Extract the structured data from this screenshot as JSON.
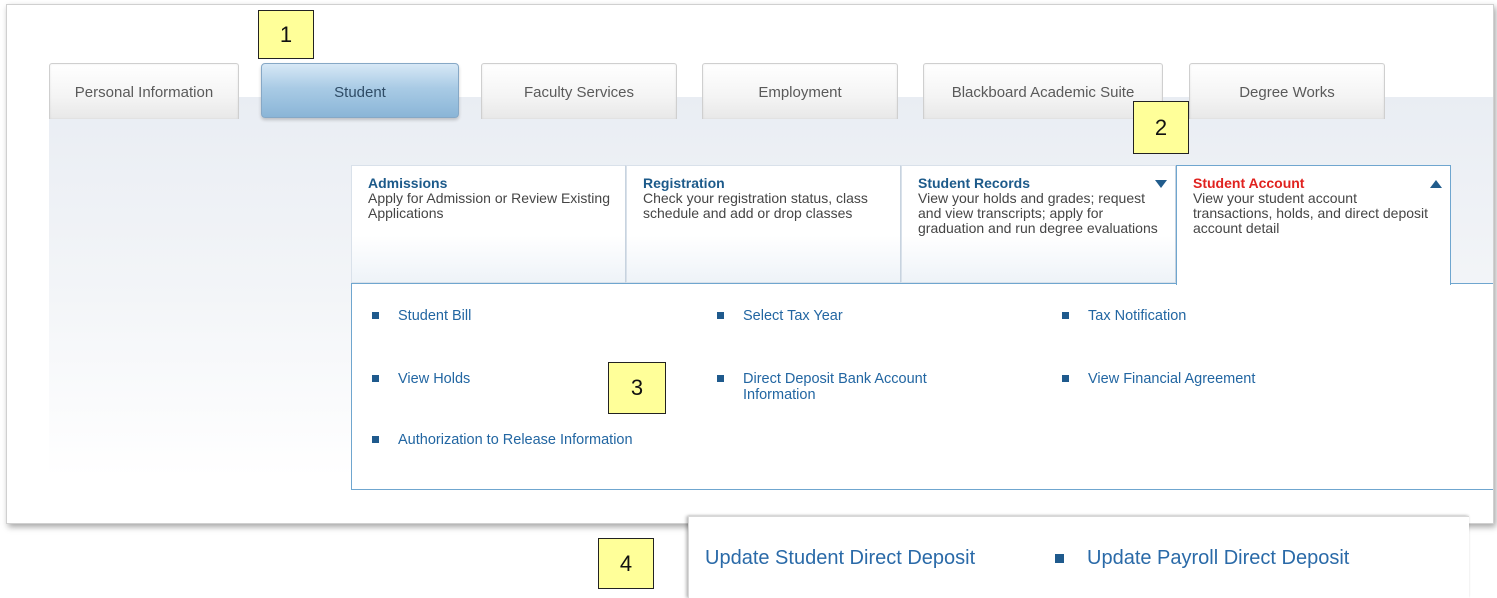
{
  "tabs": [
    {
      "label": "Personal Information"
    },
    {
      "label": "Student",
      "active": true
    },
    {
      "label": "Faculty Services"
    },
    {
      "label": "Employment"
    },
    {
      "label": "Blackboard Academic Suite"
    },
    {
      "label": "Degree Works"
    }
  ],
  "cards": [
    {
      "title": "Admissions",
      "description": "Apply for Admission or Review Existing Applications"
    },
    {
      "title": "Registration",
      "description": "Check your registration status, class schedule and add or drop classes"
    },
    {
      "title": "Student Records",
      "description": "View your holds and grades; request and view transcripts; apply for graduation and run degree evaluations",
      "arrow": "down"
    },
    {
      "title": "Student Account",
      "description": "View your student account transactions, holds, and direct deposit account detail",
      "arrow": "up",
      "active": true
    }
  ],
  "links": [
    {
      "label": "Student Bill"
    },
    {
      "label": "Select Tax Year"
    },
    {
      "label": "Tax Notification"
    },
    {
      "label": "View Holds"
    },
    {
      "label": "Direct Deposit Bank Account Information"
    },
    {
      "label": "View Financial Agreement"
    },
    {
      "label": "Authorization to Release Information"
    }
  ],
  "inset": {
    "link1": "Update Student Direct Deposit",
    "link2": "Update Payroll Direct Deposit"
  },
  "callouts": [
    "1",
    "2",
    "3",
    "4"
  ],
  "colors": {
    "link": "#2266a2",
    "active_card_title": "#e0221f",
    "callout_fill": "#ffff99",
    "active_tab": "#a9cbe5"
  }
}
